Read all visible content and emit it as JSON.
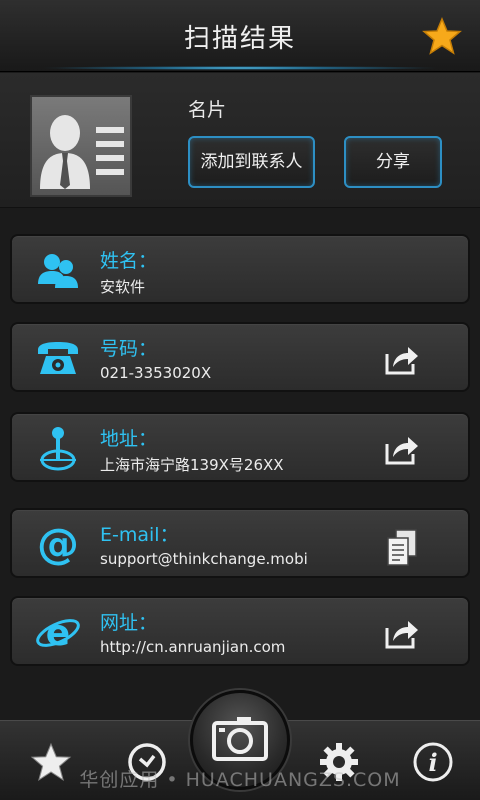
{
  "header": {
    "title": "扫描结果",
    "star_icon": "star-icon",
    "glow_color": "#6ad8ff"
  },
  "card": {
    "icon": "business-card-icon",
    "title": "名片",
    "add_contact_label": "添加到联系人",
    "share_label": "分享"
  },
  "rows": [
    {
      "icon": "contacts-icon",
      "label": "姓名：",
      "value": "安软件",
      "action": ""
    },
    {
      "icon": "telephone-icon",
      "label": "号码：",
      "value": "021-3353020X",
      "action": "share-arrow-icon"
    },
    {
      "icon": "location-pin-icon",
      "label": "地址：",
      "value": "上海市海宁路139X号26XX",
      "action": "share-arrow-icon"
    },
    {
      "icon": "at-sign-icon",
      "label": "E-mail：",
      "value": "support@thinkchange.mobi",
      "action": "copy-icon"
    },
    {
      "icon": "internet-explorer-icon",
      "label": "网址：",
      "value": "http://cn.anruanjian.com",
      "action": "share-arrow-icon"
    }
  ],
  "bottom_nav": {
    "items": [
      "favorites-star-icon",
      "history-clock-icon",
      "camera-icon",
      "settings-gear-icon",
      "info-icon"
    ]
  },
  "watermark": "华创应用 • HUACHUANGZS.COM",
  "colors": {
    "accent": "#2fc2f2",
    "button_border": "#2d8fc4",
    "star": "#f7a91a",
    "background": "#1b1b1b"
  }
}
